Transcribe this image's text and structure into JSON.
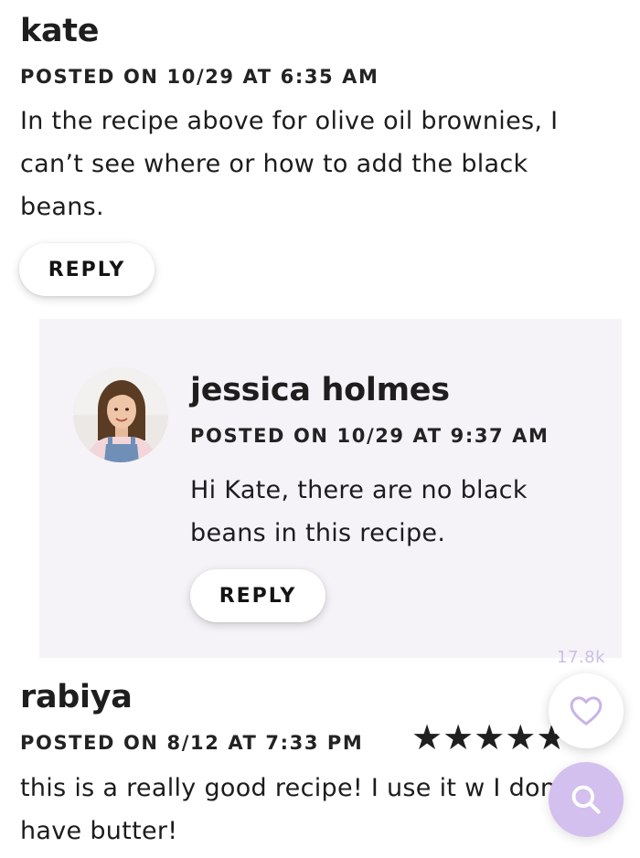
{
  "comments": [
    {
      "name": "kate",
      "posted": "POSTED ON 10/29 AT 6:35 AM",
      "text": "In the recipe above for olive oil brownies, I can’t see where or how to add the black beans.",
      "reply_label": "REPLY"
    },
    {
      "name": "jessica holmes",
      "posted": "POSTED ON 10/29 AT 9:37 AM",
      "text": "Hi Kate, there are no black beans in this recipe.",
      "reply_label": "REPLY",
      "avatar": "author-avatar"
    },
    {
      "name": "rabiya",
      "posted": "POSTED ON 8/12 AT 7:33 PM",
      "rating": "★★★★★",
      "rating_value": 5,
      "text": "this is a really good recipe! I use it w I don’t have butter!"
    }
  ],
  "floating": {
    "likes_count": "17.8k",
    "heart_icon": "heart-icon",
    "search_icon": "search-icon"
  },
  "colors": {
    "reply_panel_bg": "#f5f2f8",
    "accent_lavender": "#d3c0ee",
    "heart_stroke": "#c9b4e6",
    "likes_text": "#cdbfe4"
  }
}
